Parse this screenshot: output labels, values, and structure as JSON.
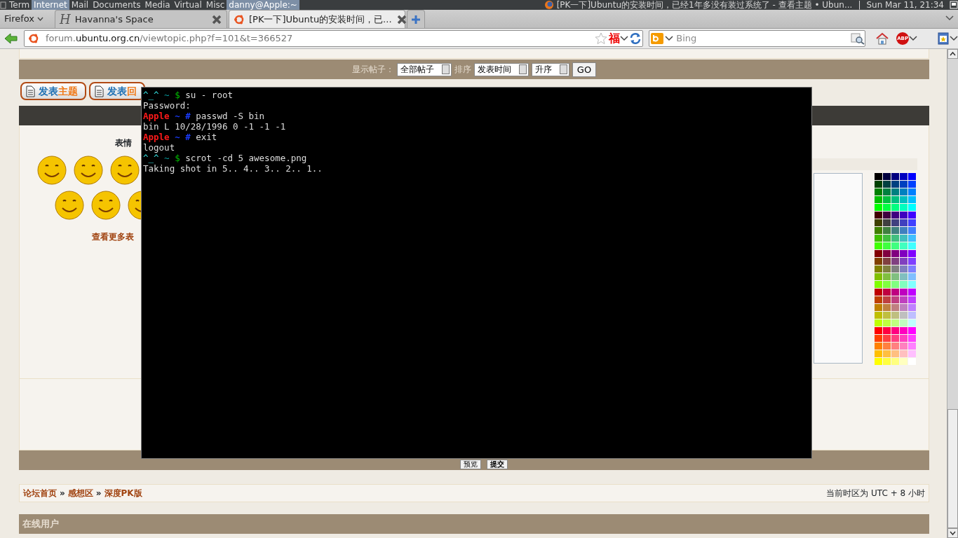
{
  "top_panel": {
    "menus": [
      {
        "label": "Term",
        "selected": false
      },
      {
        "label": "Internet",
        "selected": true
      },
      {
        "label": "Mail",
        "selected": false
      },
      {
        "label": "Documents",
        "selected": false
      },
      {
        "label": "Media",
        "selected": false
      },
      {
        "label": "Virtual",
        "selected": false
      },
      {
        "label": "Misc",
        "selected": false
      }
    ],
    "task": {
      "label": "danny@Apple:~",
      "selected": true
    },
    "window_title": "[PK一下]Ubuntu的安装时间，已经1年多没有装过系统了 - 查看主题 • Ubun...",
    "separator": "|",
    "clock": "Sun Mar 11, 21:34"
  },
  "browser": {
    "menu_button": "Firefox",
    "tabs": [
      {
        "title": "Havanna's Space",
        "favicon_text": "H",
        "selected": false
      },
      {
        "title": "[PK一下]Ubuntu的安装时间，已...",
        "selected": true
      }
    ],
    "url": "forum.**ubuntu.org.cn**/viewtopic.php?f=101&t=366527",
    "extension_label": "福",
    "search": {
      "placeholder": "Bing"
    },
    "adblock_label": "ABP"
  },
  "forum": {
    "filter": {
      "label": "显示帖子：",
      "show": "全部帖子",
      "sort_label": "排序",
      "sort_by": "发表时间",
      "order": "升序",
      "go": "GO"
    },
    "actions": [
      {
        "verb": "发表",
        "object": "主题"
      },
      {
        "verb": "发表",
        "object": "回"
      }
    ],
    "emoticons": {
      "title": "表情",
      "more_link": "查看更多表"
    },
    "editor_buttons": [
      "预览",
      "提交"
    ],
    "breadcrumb": {
      "items": [
        "论坛首页",
        "感想区",
        "深度PK版"
      ],
      "separator": "»"
    },
    "timezone": "当前时区为 UTC + 8 小时",
    "online_title": "在线用户"
  },
  "terminal": {
    "lines": [
      {
        "kind": "user_prompt",
        "host": "^_^",
        "cwd": "~",
        "symbol": "$",
        "command": "su - root"
      },
      {
        "kind": "output",
        "text": "Password:"
      },
      {
        "kind": "root_prompt",
        "host": "Apple",
        "cwd": "~",
        "symbol": "#",
        "command": "passwd -S bin"
      },
      {
        "kind": "output",
        "text": "bin L 10/28/1996 0 -1 -1 -1"
      },
      {
        "kind": "root_prompt",
        "host": "Apple",
        "cwd": "~",
        "symbol": "#",
        "command": "exit"
      },
      {
        "kind": "output",
        "text": "logout"
      },
      {
        "kind": "user_prompt",
        "host": "^_^",
        "cwd": "~",
        "symbol": "$",
        "command": "scrot -cd 5 awesome.png"
      },
      {
        "kind": "output",
        "text": "Taking shot in 5.. 4.. 3.. 2.. 1.."
      }
    ]
  }
}
